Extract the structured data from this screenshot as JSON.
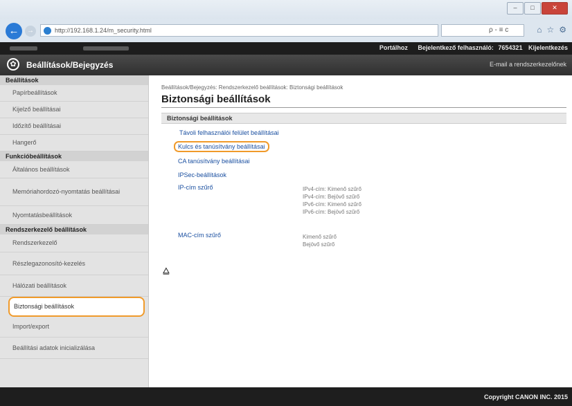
{
  "browser": {
    "url": "http://192.168.1.24/m_security.html",
    "search_label": "ρ - ≡ c",
    "window_buttons": {
      "minimize": "–",
      "maximize": "□",
      "close": "✕"
    },
    "toolbar_icons": [
      "home-icon",
      "star-icon",
      "gear-icon"
    ]
  },
  "topbar": {
    "portal": "Portálhoz",
    "logged_in_label": "Bejelentkező felhasználó:",
    "user_id": "7654321",
    "logout": "Kijelentkezés"
  },
  "header": {
    "title": "Beállítások/Bejegyzés",
    "mail_link": "E-mail a rendszerkezelőnek"
  },
  "sidebar": {
    "sections": [
      {
        "title": "Beállítások",
        "items": [
          "Papírbeállítások",
          "Kijelző beállításai",
          "Időzítő beállításai",
          "Hangerő"
        ]
      },
      {
        "title": "Funkcióbeállítások",
        "items": [
          "Általános beállítások",
          "Memóriahordozó-nyomtatás beállításai",
          "Nyomtatásbeállítások"
        ]
      },
      {
        "title": "Rendszerkezelő beállítások",
        "items": [
          "Rendszerkezelő",
          "Részlegazonosító-kezelés",
          "Hálózati beállítások",
          "Biztonsági beállítások",
          "Import/export",
          "Beállítási adatok inicializálása"
        ]
      }
    ],
    "selected": "Biztonsági beállítások"
  },
  "main": {
    "breadcrumb": "Beállítások/Bejegyzés: Rendszerkezelő beállítások: Biztonsági beállítások",
    "title": "Biztonsági beállítások",
    "section_title": "Biztonsági beállítások",
    "links": {
      "remote_ui": "Távoli felhasználói felület beállításai",
      "key_cert": "Kulcs és tanúsítvány beállításai",
      "ca_cert": "CA tanúsítvány beállításai",
      "ipsec": "IPSec-beállítások",
      "ip_filter": "IP-cím szűrő",
      "mac_filter": "MAC-cím szűrő"
    },
    "ip_filter_desc": [
      "IPv4-cím: Kimenő szűrő",
      "IPv4-cím: Bejövő szűrő",
      "IPv6-cím: Kimenő szűrő",
      "IPv6-cím: Bejövő szűrő"
    ],
    "mac_filter_desc": [
      "Kimenő szűrő",
      "Bejövő szűrő"
    ],
    "to_top": "⧋"
  },
  "footer": {
    "copyright": "Copyright CANON INC. 2015"
  },
  "colors": {
    "highlight": "#f09a2a",
    "link": "#1a4fa0",
    "header": "#303030"
  }
}
